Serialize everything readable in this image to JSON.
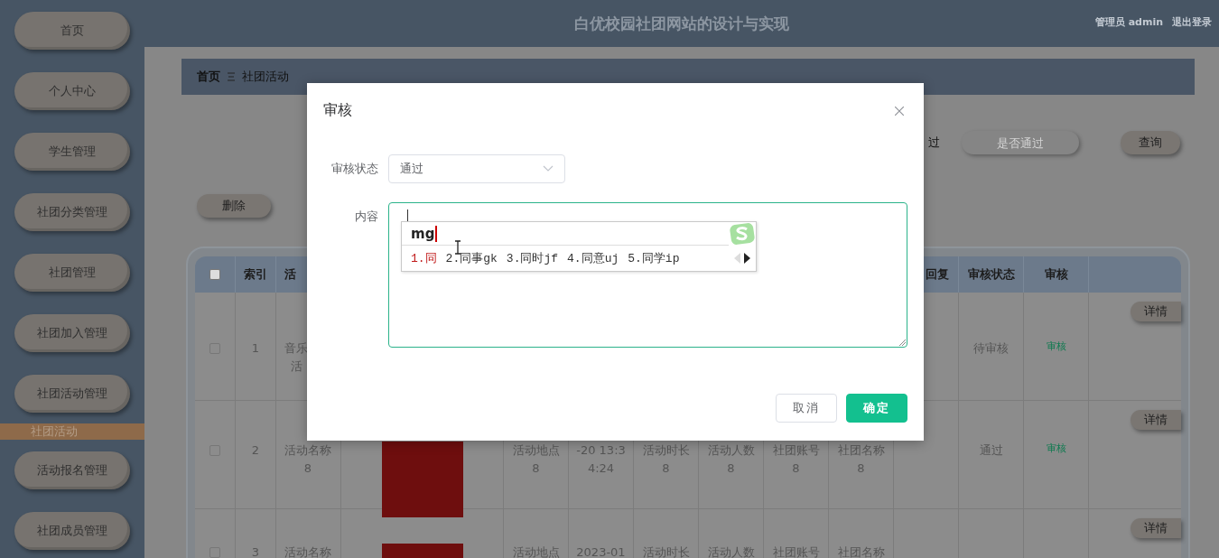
{
  "header": {
    "title": "白优校园社团网站的设计与实现",
    "user": "管理员 admin",
    "logout": "退出登录"
  },
  "sidebar": {
    "items": [
      {
        "label": "首页",
        "selected": false
      },
      {
        "label": "个人中心",
        "selected": false
      },
      {
        "label": "学生管理",
        "selected": false
      },
      {
        "label": "社团分类管理",
        "selected": false
      },
      {
        "label": "社团管理",
        "selected": false
      },
      {
        "label": "社团加入管理",
        "selected": false
      },
      {
        "label": "社团活动管理",
        "selected": false
      },
      {
        "label": "社团活动",
        "selected": true
      },
      {
        "label": "活动报名管理",
        "selected": false
      },
      {
        "label": "社团成员管理",
        "selected": false
      }
    ]
  },
  "breadcrumb": [
    {
      "label": "首页"
    },
    {
      "label": "社团活动"
    }
  ],
  "search": {
    "label": "过",
    "placeholder": "是否通过",
    "button": "查询"
  },
  "toolbar": {
    "delete": "删除"
  },
  "table": {
    "header": {
      "checked": false,
      "index": "索引",
      "column_3": "活",
      "column_11": "回复",
      "status": "审核状态",
      "review": "审核"
    },
    "rows": [
      {
        "checked": false,
        "index": "1",
        "column_3": [
          "音乐",
          "活"
        ],
        "status": "待审核",
        "review": "审核",
        "action": "详情"
      },
      {
        "checked": false,
        "index": "2",
        "column_3": "活动名称\n8",
        "poster": true,
        "column_5": "活动地点\n8",
        "column_6": "-20 13:3\n4:24",
        "column_7": "活动时长\n8",
        "column_8": "活动人数\n8",
        "column_9": "社团账号\n8",
        "column_10": "社团名称\n8",
        "status": "通过",
        "review": "审核",
        "action": "详情"
      },
      {
        "checked": false,
        "index": "3",
        "column_3": "活动名称",
        "poster": true,
        "column_5": "活动地点",
        "column_6": "2023-01",
        "column_7": "活动时长",
        "column_8": "活动人数",
        "column_9": "社团账号",
        "column_10": "社团名称",
        "action": "详情"
      }
    ]
  },
  "dialog": {
    "title": "审核",
    "fields": [
      {
        "kind": "select",
        "label": "审核状态",
        "value": "通过"
      },
      {
        "kind": "textarea",
        "label": "内容",
        "focused": true
      }
    ],
    "ime": {
      "composition": "mg",
      "candidates": [
        {
          "label": "1.同",
          "selected": true
        },
        {
          "label": "2.同事gk",
          "selected": false
        },
        {
          "label": "3.同时jf",
          "selected": false
        },
        {
          "label": "4.同意uj",
          "selected": false
        },
        {
          "label": "5.同学ip",
          "selected": false
        }
      ],
      "prev_disabled": true,
      "next_disabled": false
    },
    "buttons": [
      {
        "label": "取消",
        "kind": "default"
      },
      {
        "label": "确定",
        "kind": "primary"
      }
    ]
  }
}
